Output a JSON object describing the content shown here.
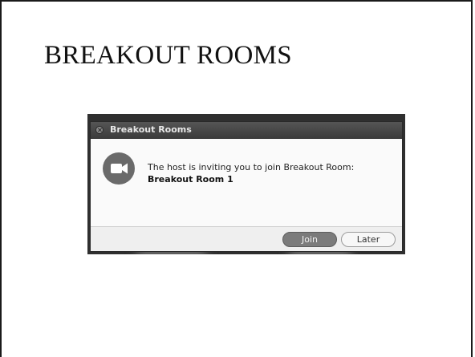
{
  "slide": {
    "title": "BREAKOUT ROOMS"
  },
  "dialog": {
    "window_title": "Breakout Rooms",
    "message": "The host is inviting you to join Breakout Room:",
    "room_name": "Breakout Room 1",
    "join_label": "Join",
    "later_label": "Later",
    "icon": "video-camera-icon"
  },
  "colors": {
    "titlebar": "#444444",
    "join_button": "#7b7b7b",
    "camera_badge": "#6a6a6a"
  }
}
